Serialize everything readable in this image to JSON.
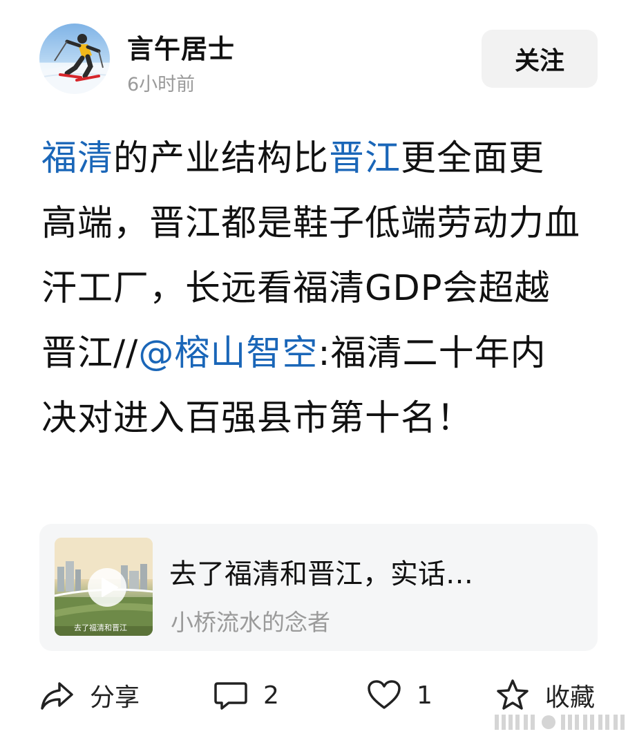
{
  "user": {
    "name": "言午居士",
    "time": "6小时前",
    "follow_label": "关注"
  },
  "post": {
    "segments": [
      {
        "text": "福清",
        "link": true
      },
      {
        "text": "的产业结构比",
        "link": false
      },
      {
        "text": "晋江",
        "link": true
      },
      {
        "text": "更全面更高端，晋江都是鞋子低端劳动力血汗工厂，长远看福清GDP会超越晋江//",
        "link": false
      },
      {
        "text": "@榕山智空",
        "link": true
      },
      {
        "text": ":福清二十年内决对进入百强县市第十名！",
        "link": false
      }
    ]
  },
  "shared_card": {
    "title": "去了福清和晋江，实话…",
    "author": "小桥流水的念者",
    "thumb_caption": "去了福清和晋江"
  },
  "actions": {
    "share_label": "分享",
    "comment_count": "2",
    "like_count": "1",
    "favorite_label": "收藏"
  },
  "colors": {
    "link": "#1a66b8",
    "text": "#111111",
    "muted": "#9a9a9a",
    "card_bg": "#f5f6f7"
  }
}
